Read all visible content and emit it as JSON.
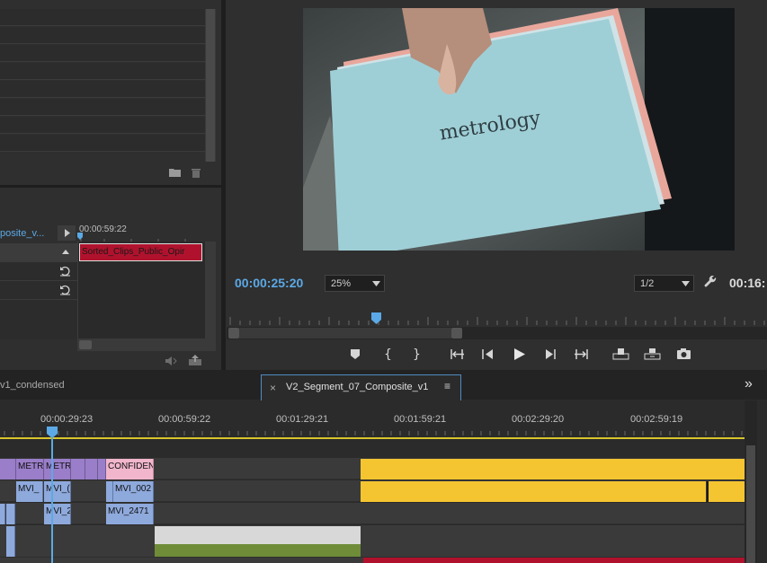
{
  "colors": {
    "accent_blue": "#5ba9e6",
    "clip_purple": "#9a7ec9",
    "clip_blue": "#8ea9dc",
    "clip_pink": "#f1b6cc",
    "clip_yellow": "#f5c531",
    "clip_red": "#b0122d",
    "clip_green": "#6f8c38",
    "clip_gray": "#d6d6d6"
  },
  "source_panel": {
    "sequence_tab": "posite_v...",
    "timecode_ruler": "00:00:59:22",
    "clip_label": "Sorted_Clips_Public_Opir"
  },
  "program_monitor": {
    "video_text": "metrology",
    "timecode": "00:00:25:20",
    "zoom": "25%",
    "resolution": "1/2",
    "duration_partial": "00:16:"
  },
  "timeline": {
    "tabs": [
      {
        "label": "v1_condensed"
      },
      {
        "label": "V2_Segment_07_Composite_v1"
      }
    ],
    "active_tab_close": "×",
    "active_tab_menu": "≡",
    "overflow": "»",
    "ruler_labels": [
      "00:00:29:23",
      "00:00:59:22",
      "00:01:29:21",
      "00:01:59:21",
      "00:02:29:20",
      "00:02:59:19"
    ],
    "clips": {
      "v3_a": "METR",
      "v3_b": "METR",
      "v3_c": "CONFIDEN",
      "v2_a": "MVI_",
      "v2_b": "MVI_(",
      "v2_c": "MVI_002",
      "v1_a": "MVI_2",
      "v1_b": "MVI_2471"
    }
  }
}
